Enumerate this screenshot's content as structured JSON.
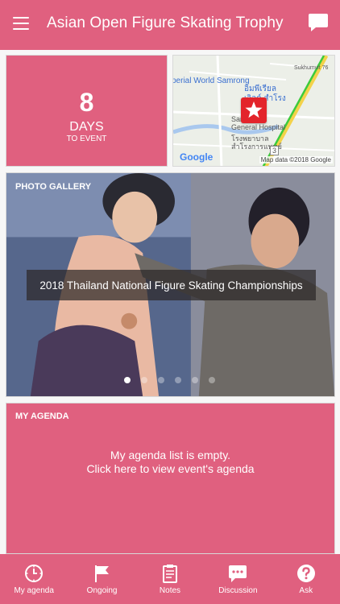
{
  "header": {
    "title": "Asian Open Figure Skating Trophy",
    "menu_icon": "hamburger-menu-icon",
    "chat_icon": "chat-bubble-icon"
  },
  "countdown": {
    "days": "8",
    "label": "DAYS",
    "sublabel": "TO EVENT"
  },
  "map": {
    "labels": [
      "Sukhumvit 76",
      "perial World Samrong",
      "อิมพีเรียล",
      "เวิลด์ สำโรง",
      "Samrong",
      "General Hospital",
      "โรงพยาบาล",
      "สำโรงการแพทย์",
      "3"
    ],
    "logo": "Google",
    "attribution": "Map data ©2018 Google",
    "marker_icon": "star-marker-icon"
  },
  "gallery": {
    "label": "PHOTO GALLERY",
    "caption": "2018 Thailand National Figure Skating Championships",
    "slides": 6,
    "active_slide": 1
  },
  "agenda": {
    "label": "MY AGENDA",
    "message_line1": "My agenda list is empty.",
    "message_line2": "Click here to view event's agenda"
  },
  "tabs": [
    {
      "label": "My agenda",
      "icon": "clock-icon"
    },
    {
      "label": "Ongoing",
      "icon": "flag-icon"
    },
    {
      "label": "Notes",
      "icon": "clipboard-icon"
    },
    {
      "label": "Discussion",
      "icon": "chat-icon"
    },
    {
      "label": "Ask",
      "icon": "question-icon"
    }
  ],
  "colors": {
    "primary": "#e0607f",
    "text_on_primary": "#ffffff",
    "background": "#f7f7f7",
    "marker": "#e3242b"
  }
}
